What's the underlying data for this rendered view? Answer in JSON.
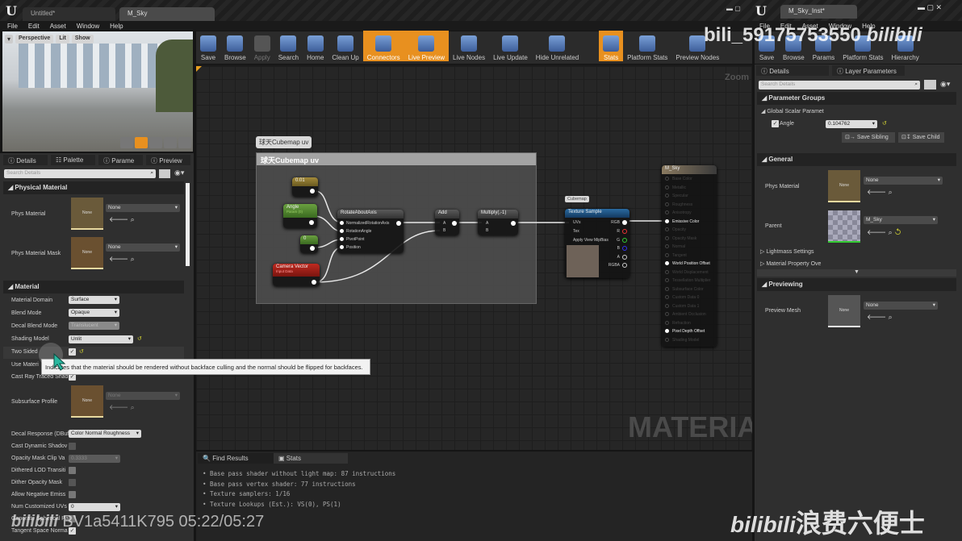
{
  "main_window": {
    "tabs": [
      "Untitled*",
      "M_Sky"
    ],
    "menu": [
      "File",
      "Edit",
      "Asset",
      "Window",
      "Help"
    ]
  },
  "viewport": {
    "buttons": [
      "Perspective",
      "Lit",
      "Show"
    ]
  },
  "toolbar": [
    {
      "label": "Save"
    },
    {
      "label": "Browse"
    },
    {
      "label": "Apply",
      "disabled": true
    },
    {
      "label": "Search"
    },
    {
      "label": "Home"
    },
    {
      "label": "Clean Up"
    },
    {
      "label": "Connectors",
      "active": true
    },
    {
      "label": "Live Preview",
      "active": true
    },
    {
      "label": "Live Nodes"
    },
    {
      "label": "Live Update"
    },
    {
      "label": "Hide Unrelated"
    },
    {
      "label": "Stats",
      "active": true
    },
    {
      "label": "Platform Stats"
    },
    {
      "label": "Preview Nodes"
    }
  ],
  "graph": {
    "zoom_label": "Zoom",
    "watermark": "MATERIAL",
    "comment_bubble": "球天Cubemap uv",
    "comment_title": "球天Cubemap uv",
    "nodes": {
      "const1": "0.01",
      "angle": "Angle",
      "angle_sub": "Param (0)",
      "const0": "0",
      "camera": "Camera Vector",
      "camera_sub": "Input Data",
      "rotate": "RotateAboutAxis",
      "rotate_pins": [
        "NormalizedRotationAxis",
        "RotationAngle",
        "PivotPoint",
        "Position"
      ],
      "add": "Add",
      "multiply": "Multiply(,-1)",
      "ab": [
        "A",
        "B"
      ],
      "cubemap_bubble": "Cubemap",
      "texture": "Texture Sample",
      "texture_in": [
        "UVs",
        "Tex",
        "Apply View MipBias"
      ],
      "texture_out": [
        "RGB",
        "R",
        "G",
        "B",
        "A",
        "RGBA"
      ],
      "result": "M_Sky",
      "result_pins": [
        "Base Color",
        "Metallic",
        "Specular",
        "Roughness",
        "Anisotropy",
        "Emissive Color",
        "Opacity",
        "Opacity Mask",
        "Normal",
        "Tangent",
        "World Position Offset",
        "World Displacement",
        "Tessellation Multiplier",
        "Subsurface Color",
        "Custom Data 0",
        "Custom Data 1",
        "Ambient Occlusion",
        "Refraction",
        "Pixel Depth Offset",
        "Shading Model"
      ],
      "result_active": [
        5,
        10,
        18
      ]
    }
  },
  "bottom": {
    "tabs": [
      "Find Results",
      "Stats"
    ],
    "stats": [
      "Base pass shader without light map: 87 instructions",
      "Base pass vertex shader: 77 instructions",
      "Texture samplers: 1/16",
      "Texture Lookups (Est.): VS(0), PS(1)"
    ]
  },
  "details": {
    "tabs": [
      "Details",
      "Palette",
      "Parame",
      "Preview"
    ],
    "search_placeholder": "Search Details",
    "physical": {
      "title": "Physical Material",
      "phys_material": "Phys Material",
      "phys_mask": "Phys Material Mask",
      "none": "None"
    },
    "material": {
      "title": "Material",
      "domain_label": "Material Domain",
      "domain": "Surface",
      "blend_label": "Blend Mode",
      "blend": "Opaque",
      "decal_label": "Decal Blend Mode",
      "decal": "Translucent",
      "shading_label": "Shading Model",
      "shading": "Unlit",
      "two_sided_label": "Two Sided",
      "use_mat_label": "Use Materi",
      "cast_ray_label": "Cast Ray Traced Shad",
      "subsurface_label": "Subsurface Profile",
      "decal_resp_label": "Decal Response (DBuf",
      "decal_resp": "Color Normal Roughness",
      "cast_dyn_label": "Cast Dynamic Shadov",
      "clip_label": "Opacity Mask Clip Va",
      "clip": "0.3333",
      "dithered_label": "Dithered LOD Transiti",
      "dither_label": "Dither Opacity Mask",
      "neg_label": "Allow Negative Emiss",
      "uvs_label": "Num Customized UVs",
      "uvs": "0",
      "spherical_label": "Generate Spherical Pa",
      "tangent_label": "Tangent Space Norma"
    }
  },
  "tooltip": "Indicates that the material should be rendered without backface culling and the normal should be flipped for backfaces.",
  "instance_window": {
    "tab": "M_Sky_Inst*",
    "menu": [
      "File",
      "Edit",
      "Asset",
      "Window",
      "Help"
    ],
    "toolbar": [
      "Save",
      "Browse",
      "Params",
      "Platform Stats",
      "Hierarchy"
    ],
    "panel_tabs": [
      "Details",
      "Layer Parameters"
    ],
    "search_placeholder": "Search Details",
    "param_groups": "Parameter Groups",
    "global_scalar": "Global Scalar Paramet",
    "angle_label": "Angle",
    "angle_value": "0.104762",
    "save_sibling": "Save Sibling",
    "save_child": "Save Child",
    "general": "General",
    "phys_material": "Phys Material",
    "none": "None",
    "parent_label": "Parent",
    "parent": "M_Sky",
    "lightmass": "Lightmass Settings",
    "mat_prop": "Material Property Ove",
    "previewing": "Previewing",
    "preview_mesh": "Preview Mesh"
  },
  "overlays": {
    "user_watermark": "bili_59175753550",
    "brand": "bilibili",
    "video_id": "BV1a5411K795 05:22/05:27",
    "channel": "浪费六便士"
  }
}
